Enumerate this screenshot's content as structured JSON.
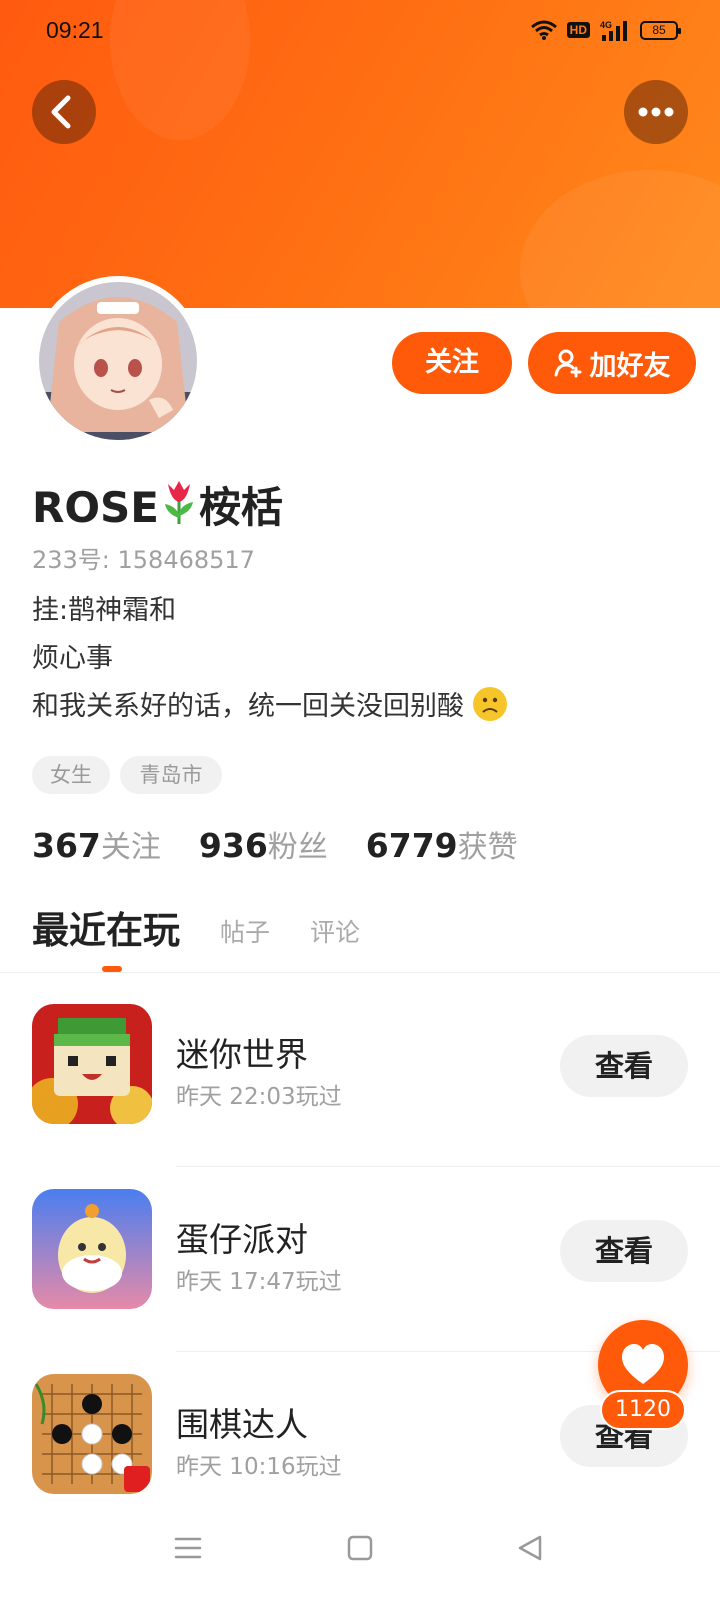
{
  "status_bar": {
    "time": "09:21",
    "battery": "85",
    "hd_label": "HD",
    "network": "4G"
  },
  "profile": {
    "nickname": "ROSE",
    "nickname_suffix": "桉栝",
    "id_line": "233号: 158468517",
    "bio": [
      "挂:鹊神霜和",
      "烦心事",
      "和我关系好的话，统一回关没回别酸"
    ],
    "tags": [
      "女生",
      "青岛市"
    ],
    "stats": [
      {
        "num": "367",
        "label": "关注"
      },
      {
        "num": "936",
        "label": "粉丝"
      },
      {
        "num": "6779",
        "label": "获赞"
      }
    ]
  },
  "actions": {
    "follow": "关注",
    "add_friend": "加好友"
  },
  "tabs": [
    "最近在玩",
    "帖子",
    "评论"
  ],
  "games": [
    {
      "name": "迷你世界",
      "time": "昨天 22:03玩过",
      "action": "查看"
    },
    {
      "name": "蛋仔派对",
      "time": "昨天 17:47玩过",
      "action": "查看"
    },
    {
      "name": "围棋达人",
      "time": "昨天 10:16玩过",
      "action": "查看"
    }
  ],
  "fab": {
    "count": "1120"
  },
  "colors": {
    "accent": "#ff5a0a",
    "header_end": "#ff8a1c",
    "muted": "#a0a0a0"
  }
}
